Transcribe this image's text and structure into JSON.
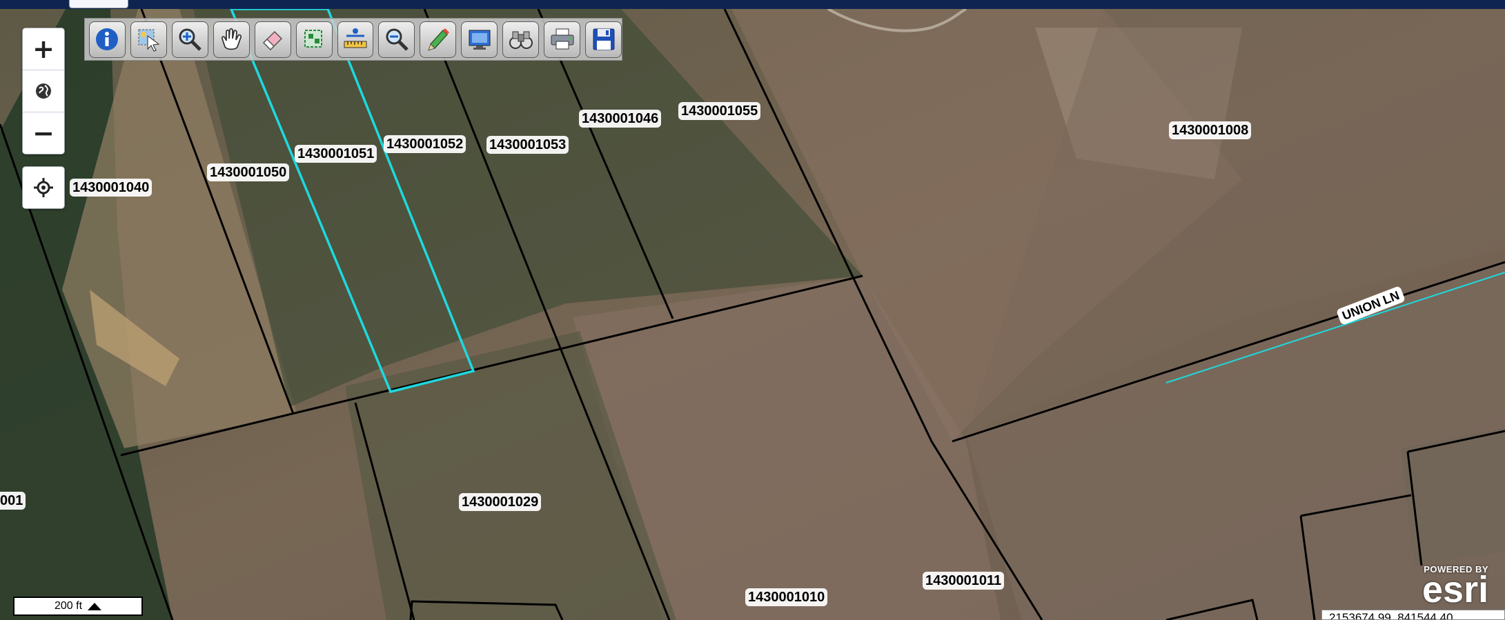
{
  "map": {
    "zoom_controls": {
      "zoom_in": "+",
      "zoom_out": "−"
    },
    "toolbar_tools": [
      {
        "icon": "info-icon"
      },
      {
        "icon": "select-icon"
      },
      {
        "icon": "zoom-in-icon"
      },
      {
        "icon": "pan-icon"
      },
      {
        "icon": "eraser-icon"
      },
      {
        "icon": "select-area-icon"
      },
      {
        "icon": "measure-icon"
      },
      {
        "icon": "zoom-out-icon"
      },
      {
        "icon": "pencil-icon"
      },
      {
        "icon": "full-extent-icon"
      },
      {
        "icon": "binoculars-icon"
      },
      {
        "icon": "print-icon"
      },
      {
        "icon": "save-icon"
      }
    ],
    "parcel_labels": [
      "1430001040",
      "1430001050",
      "1430001051",
      "1430001052",
      "1430001053",
      "1430001046",
      "1430001055",
      "1430001008",
      "1430001029",
      "1430001010",
      "1430001011",
      "001"
    ],
    "street_label": "UNION LN",
    "scale_label": "200 ft",
    "attribution": {
      "powered_by": "POWERED BY",
      "logo": "esri"
    },
    "coordinates": "2153674.99, 841544.40"
  },
  "colors": {
    "selected_parcel": "#1ed9df",
    "parcel_line": "#000000",
    "top_bar": "#0f2450"
  }
}
